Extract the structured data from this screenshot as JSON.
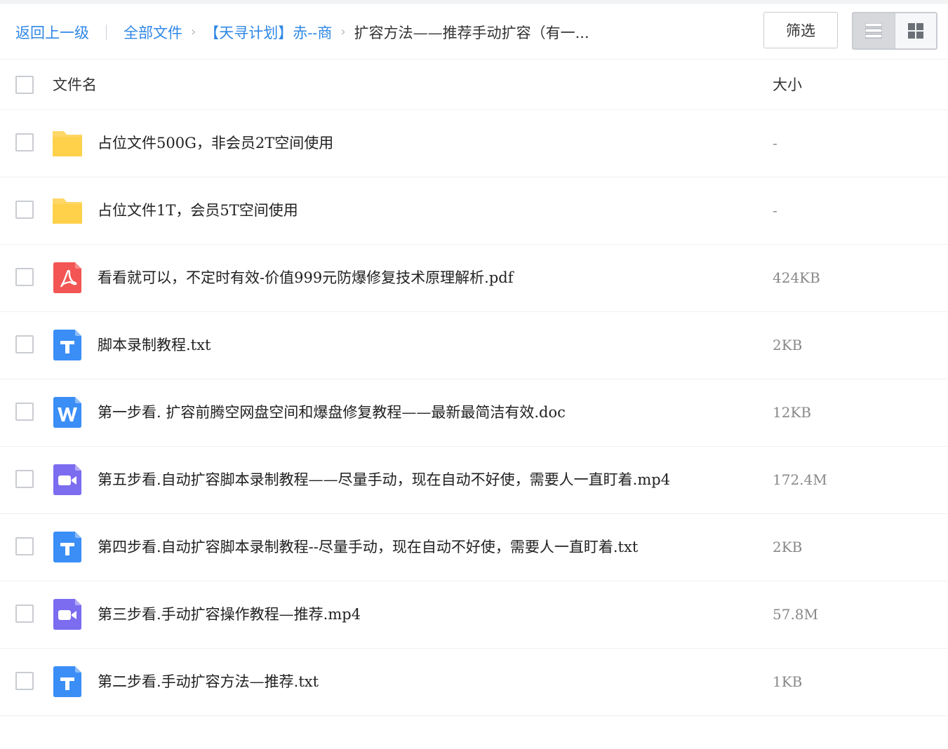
{
  "breadcrumb": {
    "back": "返回上一级",
    "all_files": "全部文件",
    "parent": "【天寻计划】赤--商",
    "current": "扩容方法——推荐手动扩容（有一..."
  },
  "toolbar": {
    "filter_label": "筛选",
    "view_mode": "list"
  },
  "columns": {
    "name": "文件名",
    "size": "大小"
  },
  "colors": {
    "link": "#2f87e6",
    "folder": "#ffd766",
    "pdf": "#f25553",
    "txt": "#3a8ef6",
    "doc": "#3a8ef6",
    "video": "#7b6cf0"
  },
  "files": [
    {
      "name": "占位文件500G，非会员2T空间使用",
      "size": "-",
      "type": "folder"
    },
    {
      "name": "占位文件1T，会员5T空间使用",
      "size": "-",
      "type": "folder"
    },
    {
      "name": "看看就可以，不定时有效-价值999元防爆修复技术原理解析.pdf",
      "size": "424KB",
      "type": "pdf"
    },
    {
      "name": "脚本录制教程.txt",
      "size": "2KB",
      "type": "txt"
    },
    {
      "name": "第一步看. 扩容前腾空网盘空间和爆盘修复教程——最新最简洁有效.doc",
      "size": "12KB",
      "type": "doc"
    },
    {
      "name": "第五步看.自动扩容脚本录制教程——尽量手动，现在自动不好使，需要人一直盯着.mp4",
      "size": "172.4M",
      "type": "video"
    },
    {
      "name": "第四步看.自动扩容脚本录制教程--尽量手动，现在自动不好使，需要人一直盯着.txt",
      "size": "2KB",
      "type": "txt"
    },
    {
      "name": "第三步看.手动扩容操作教程—推荐.mp4",
      "size": "57.8M",
      "type": "video"
    },
    {
      "name": "第二步看.手动扩容方法—推荐.txt",
      "size": "1KB",
      "type": "txt"
    }
  ]
}
